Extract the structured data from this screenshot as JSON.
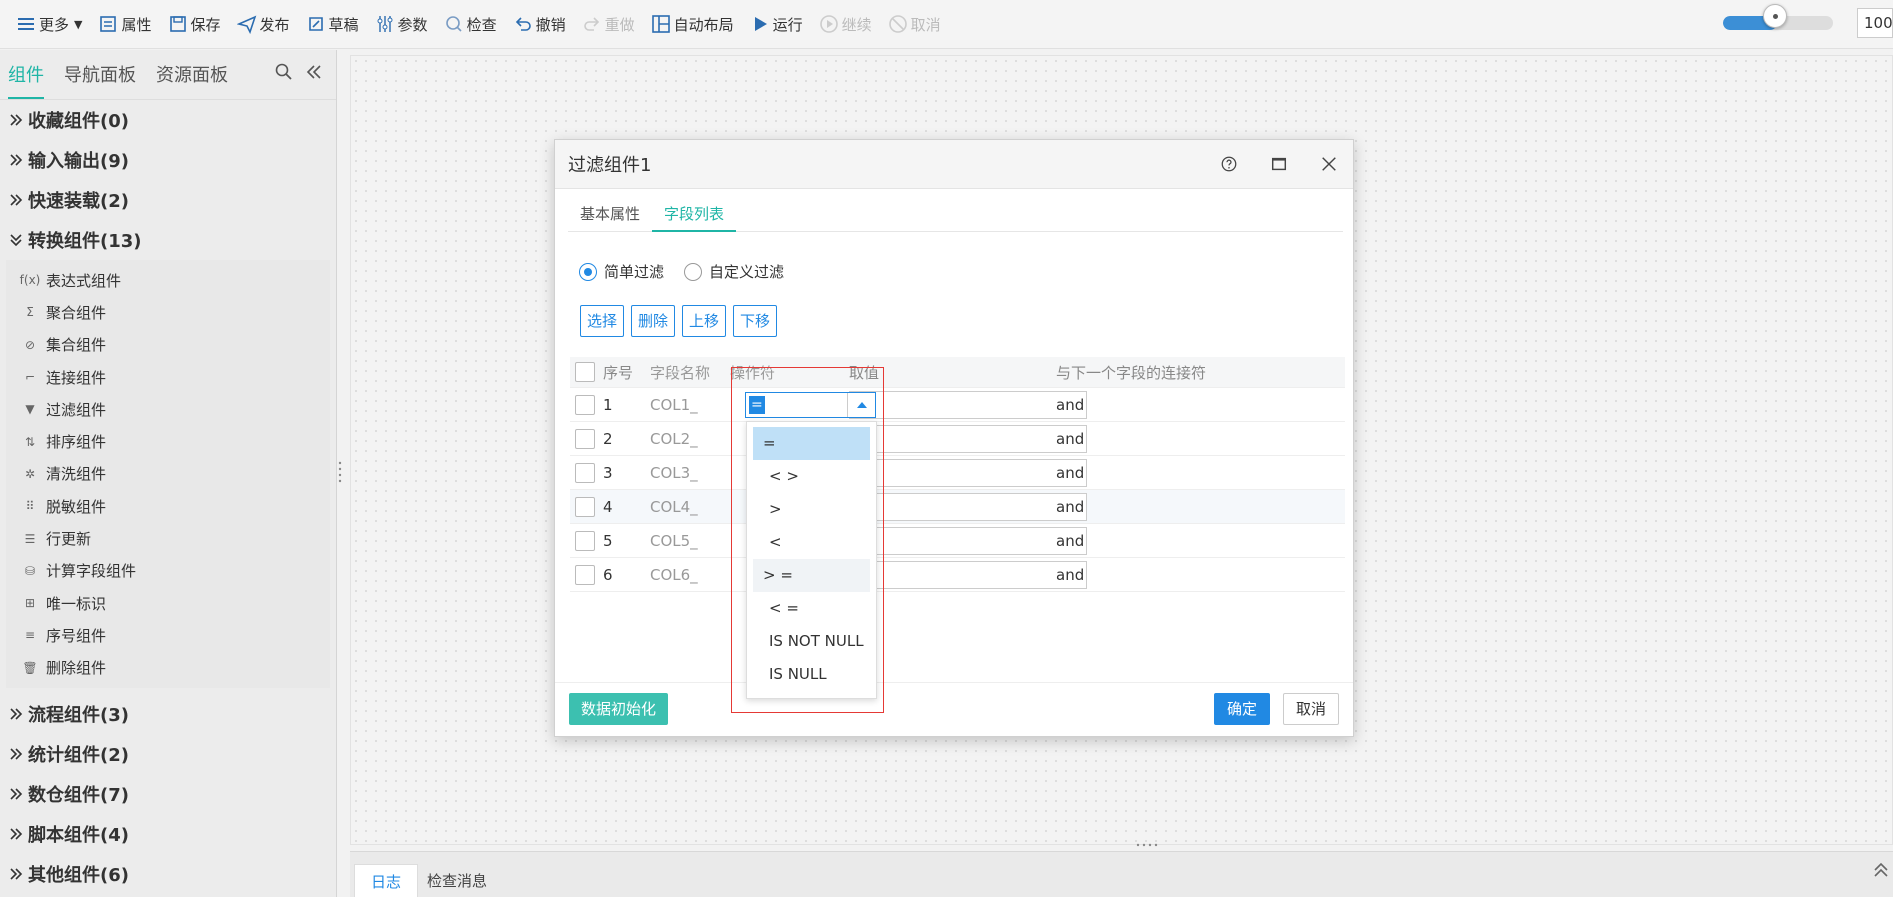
{
  "toolbar": {
    "more": "更多",
    "properties": "属性",
    "save": "保存",
    "publish": "发布",
    "draft": "草稿",
    "params": "参数",
    "check": "检查",
    "undo": "撤销",
    "redo": "重做",
    "auto_layout": "自动布局",
    "run": "运行",
    "continue": "继续",
    "cancel": "取消",
    "zoom_value": "100"
  },
  "panel": {
    "tabs": [
      "组件",
      "导航面板",
      "资源面板"
    ],
    "categories": [
      {
        "label": "收藏组件(0)"
      },
      {
        "label": "输入输出(9)"
      },
      {
        "label": "快速装载(2)"
      },
      {
        "label": "转换组件(13)"
      },
      {
        "label": "流程组件(3)"
      },
      {
        "label": "统计组件(2)"
      },
      {
        "label": "数仓组件(7)"
      },
      {
        "label": "脚本组件(4)"
      },
      {
        "label": "其他组件(6)"
      }
    ],
    "transform_items": [
      {
        "label": "表达式组件",
        "icon": "f(x)"
      },
      {
        "label": "聚合组件",
        "icon": "Σ"
      },
      {
        "label": "集合组件",
        "icon": "⊘"
      },
      {
        "label": "连接组件",
        "icon": "⌐"
      },
      {
        "label": "过滤组件",
        "icon": "▼"
      },
      {
        "label": "排序组件",
        "icon": "⇅"
      },
      {
        "label": "清洗组件",
        "icon": "✲"
      },
      {
        "label": "脱敏组件",
        "icon": "⠿"
      },
      {
        "label": "行更新",
        "icon": "☰"
      },
      {
        "label": "计算字段组件",
        "icon": "⛁"
      },
      {
        "label": "唯一标识",
        "icon": "⊞"
      },
      {
        "label": "序号组件",
        "icon": "≡"
      },
      {
        "label": "删除组件",
        "icon": "🗑"
      }
    ]
  },
  "bottom": {
    "tabs": [
      "日志",
      "检查消息"
    ]
  },
  "dialog": {
    "title": "过滤组件1",
    "tabs": [
      "基本属性",
      "字段列表"
    ],
    "radio_simple": "简单过滤",
    "radio_custom": "自定义过滤",
    "actions": [
      "选择",
      "删除",
      "上移",
      "下移"
    ],
    "headers": {
      "no": "序号",
      "name": "字段名称",
      "op": "操作符",
      "value": "取值",
      "conn": "与下一个字段的连接符"
    },
    "rows": [
      {
        "no": "1",
        "name": "COL1_",
        "conn": "and"
      },
      {
        "no": "2",
        "name": "COL2_",
        "conn": "and"
      },
      {
        "no": "3",
        "name": "COL3_",
        "conn": "and"
      },
      {
        "no": "4",
        "name": "COL4_",
        "conn": "and"
      },
      {
        "no": "5",
        "name": "COL5_",
        "conn": "and"
      },
      {
        "no": "6",
        "name": "COL6_",
        "conn": "and"
      }
    ],
    "selected_op": "=",
    "op_options": [
      "=",
      "< >",
      ">",
      "<",
      "> =",
      "< =",
      "IS NOT NULL",
      "IS NULL"
    ],
    "btn_init": "数据初始化",
    "btn_ok": "确定",
    "btn_cancel": "取消"
  },
  "colors": {
    "accent": "#1fb5a6",
    "primary": "#2189e3",
    "highlight": "#e53935"
  }
}
